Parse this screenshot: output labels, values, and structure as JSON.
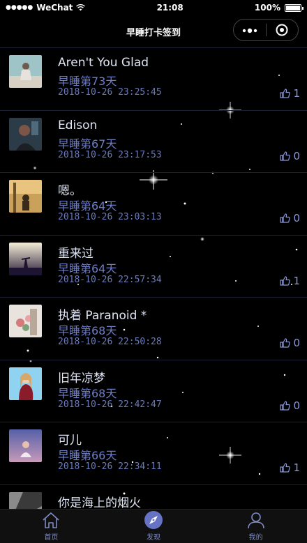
{
  "status": {
    "carrier": "WeChat",
    "time": "21:08",
    "battery": "100%"
  },
  "nav": {
    "title": "早睡打卡签到"
  },
  "items": [
    {
      "song": "Aren't You Glad",
      "day": "早睡第73天",
      "time": "2018-10-26 23:25:45",
      "likes": "1"
    },
    {
      "song": "Edison",
      "day": "早睡第67天",
      "time": "2018-10-26 23:17:53",
      "likes": "0"
    },
    {
      "song": "嗯。",
      "day": "早睡第64天",
      "time": "2018-10-26 23:03:13",
      "likes": "0"
    },
    {
      "song": "重来过",
      "day": "早睡第64天",
      "time": "2018-10-26 22:57:34",
      "likes": "1"
    },
    {
      "song": "执着 Paranoid *",
      "day": "早睡第68天",
      "time": "2018-10-26 22:50:28",
      "likes": "0"
    },
    {
      "song": "旧年凉梦",
      "day": "早睡第68天",
      "time": "2018-10-26 22:42:47",
      "likes": "0"
    },
    {
      "song": "可儿",
      "day": "早睡第66天",
      "time": "2018-10-26 22:34:11",
      "likes": "1"
    },
    {
      "song": "你是海上的烟火",
      "day": "",
      "time": "",
      "likes": ""
    }
  ],
  "tabs": [
    {
      "label": "首页",
      "icon": "home-icon"
    },
    {
      "label": "发现",
      "icon": "compass-icon"
    },
    {
      "label": "我的",
      "icon": "user-icon"
    }
  ],
  "colors": {
    "accent": "#6d7dc6",
    "background": "#000000",
    "text": "#dfe4f3"
  }
}
